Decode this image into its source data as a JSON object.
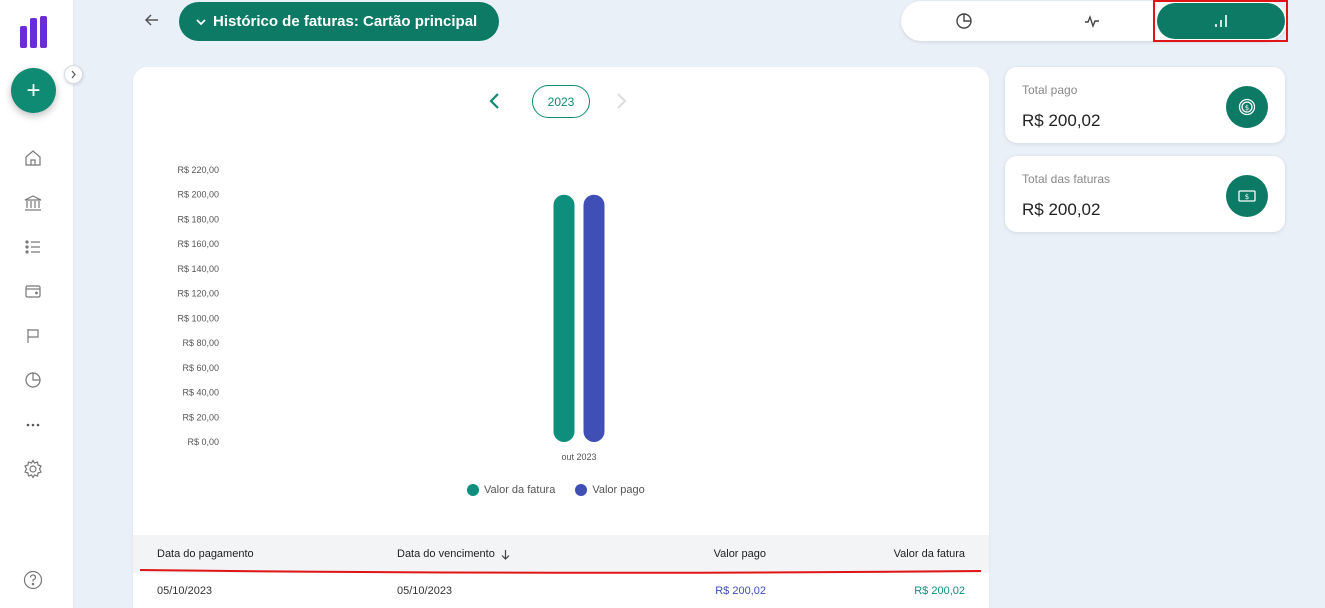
{
  "header": {
    "title": "Histórico de faturas: Cartão principal"
  },
  "view_toggle": {
    "options": [
      "pie-chart",
      "line-chart",
      "bar-chart"
    ],
    "active": "bar-chart"
  },
  "year_nav": {
    "year": "2023"
  },
  "summary": {
    "total_pago_label": "Total pago",
    "total_pago_value": "R$ 200,02",
    "total_faturas_label": "Total das faturas",
    "total_faturas_value": "R$ 200,02"
  },
  "colors": {
    "accent": "#0d7a66",
    "series_fatura": "#0e8f7e",
    "series_pago": "#3f4fb5",
    "highlight": "#e01616"
  },
  "chart_data": {
    "type": "bar",
    "categories": [
      "out 2023"
    ],
    "series": [
      {
        "name": "Valor da fatura",
        "values": [
          200.02
        ]
      },
      {
        "name": "Valor pago",
        "values": [
          200.02
        ]
      }
    ],
    "y_ticks": [
      "R$ 0,00",
      "R$ 20,00",
      "R$ 40,00",
      "R$ 60,00",
      "R$ 80,00",
      "R$ 100,00",
      "R$ 120,00",
      "R$ 140,00",
      "R$ 160,00",
      "R$ 180,00",
      "R$ 200,00",
      "R$ 220,00"
    ],
    "ylim": [
      0,
      220
    ],
    "grid": false,
    "legend_position": "bottom"
  },
  "table": {
    "headers": {
      "pagamento": "Data do pagamento",
      "vencimento": "Data do vencimento",
      "valor_pago": "Valor pago",
      "valor_fatura": "Valor da fatura"
    },
    "rows": [
      {
        "pagamento": "05/10/2023",
        "vencimento": "05/10/2023",
        "valor_pago": "R$ 200,02",
        "valor_fatura": "R$ 200,02"
      }
    ]
  }
}
